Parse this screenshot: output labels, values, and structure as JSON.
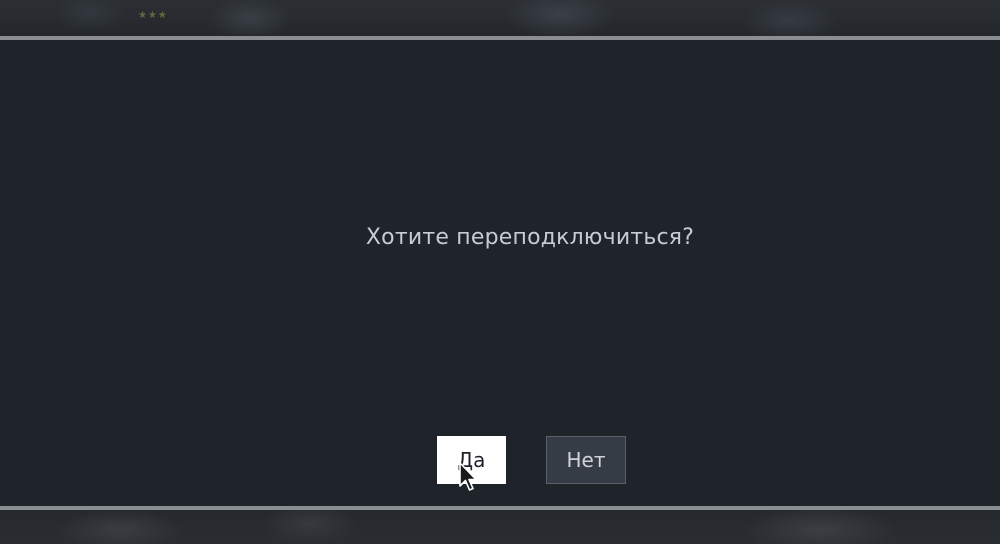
{
  "dialog": {
    "prompt": "Хотите переподключиться?",
    "yes_label": "Да",
    "no_label": "Нет"
  },
  "background": {
    "rating_stars": "★★★"
  },
  "colors": {
    "dialog_bg": "#1f232a",
    "divider": "#8a8d91",
    "prompt_text": "#c7ccd3",
    "yes_bg": "#ffffff",
    "no_bg": "#363c45"
  },
  "icons": {
    "cursor": "mouse-pointer-icon"
  }
}
